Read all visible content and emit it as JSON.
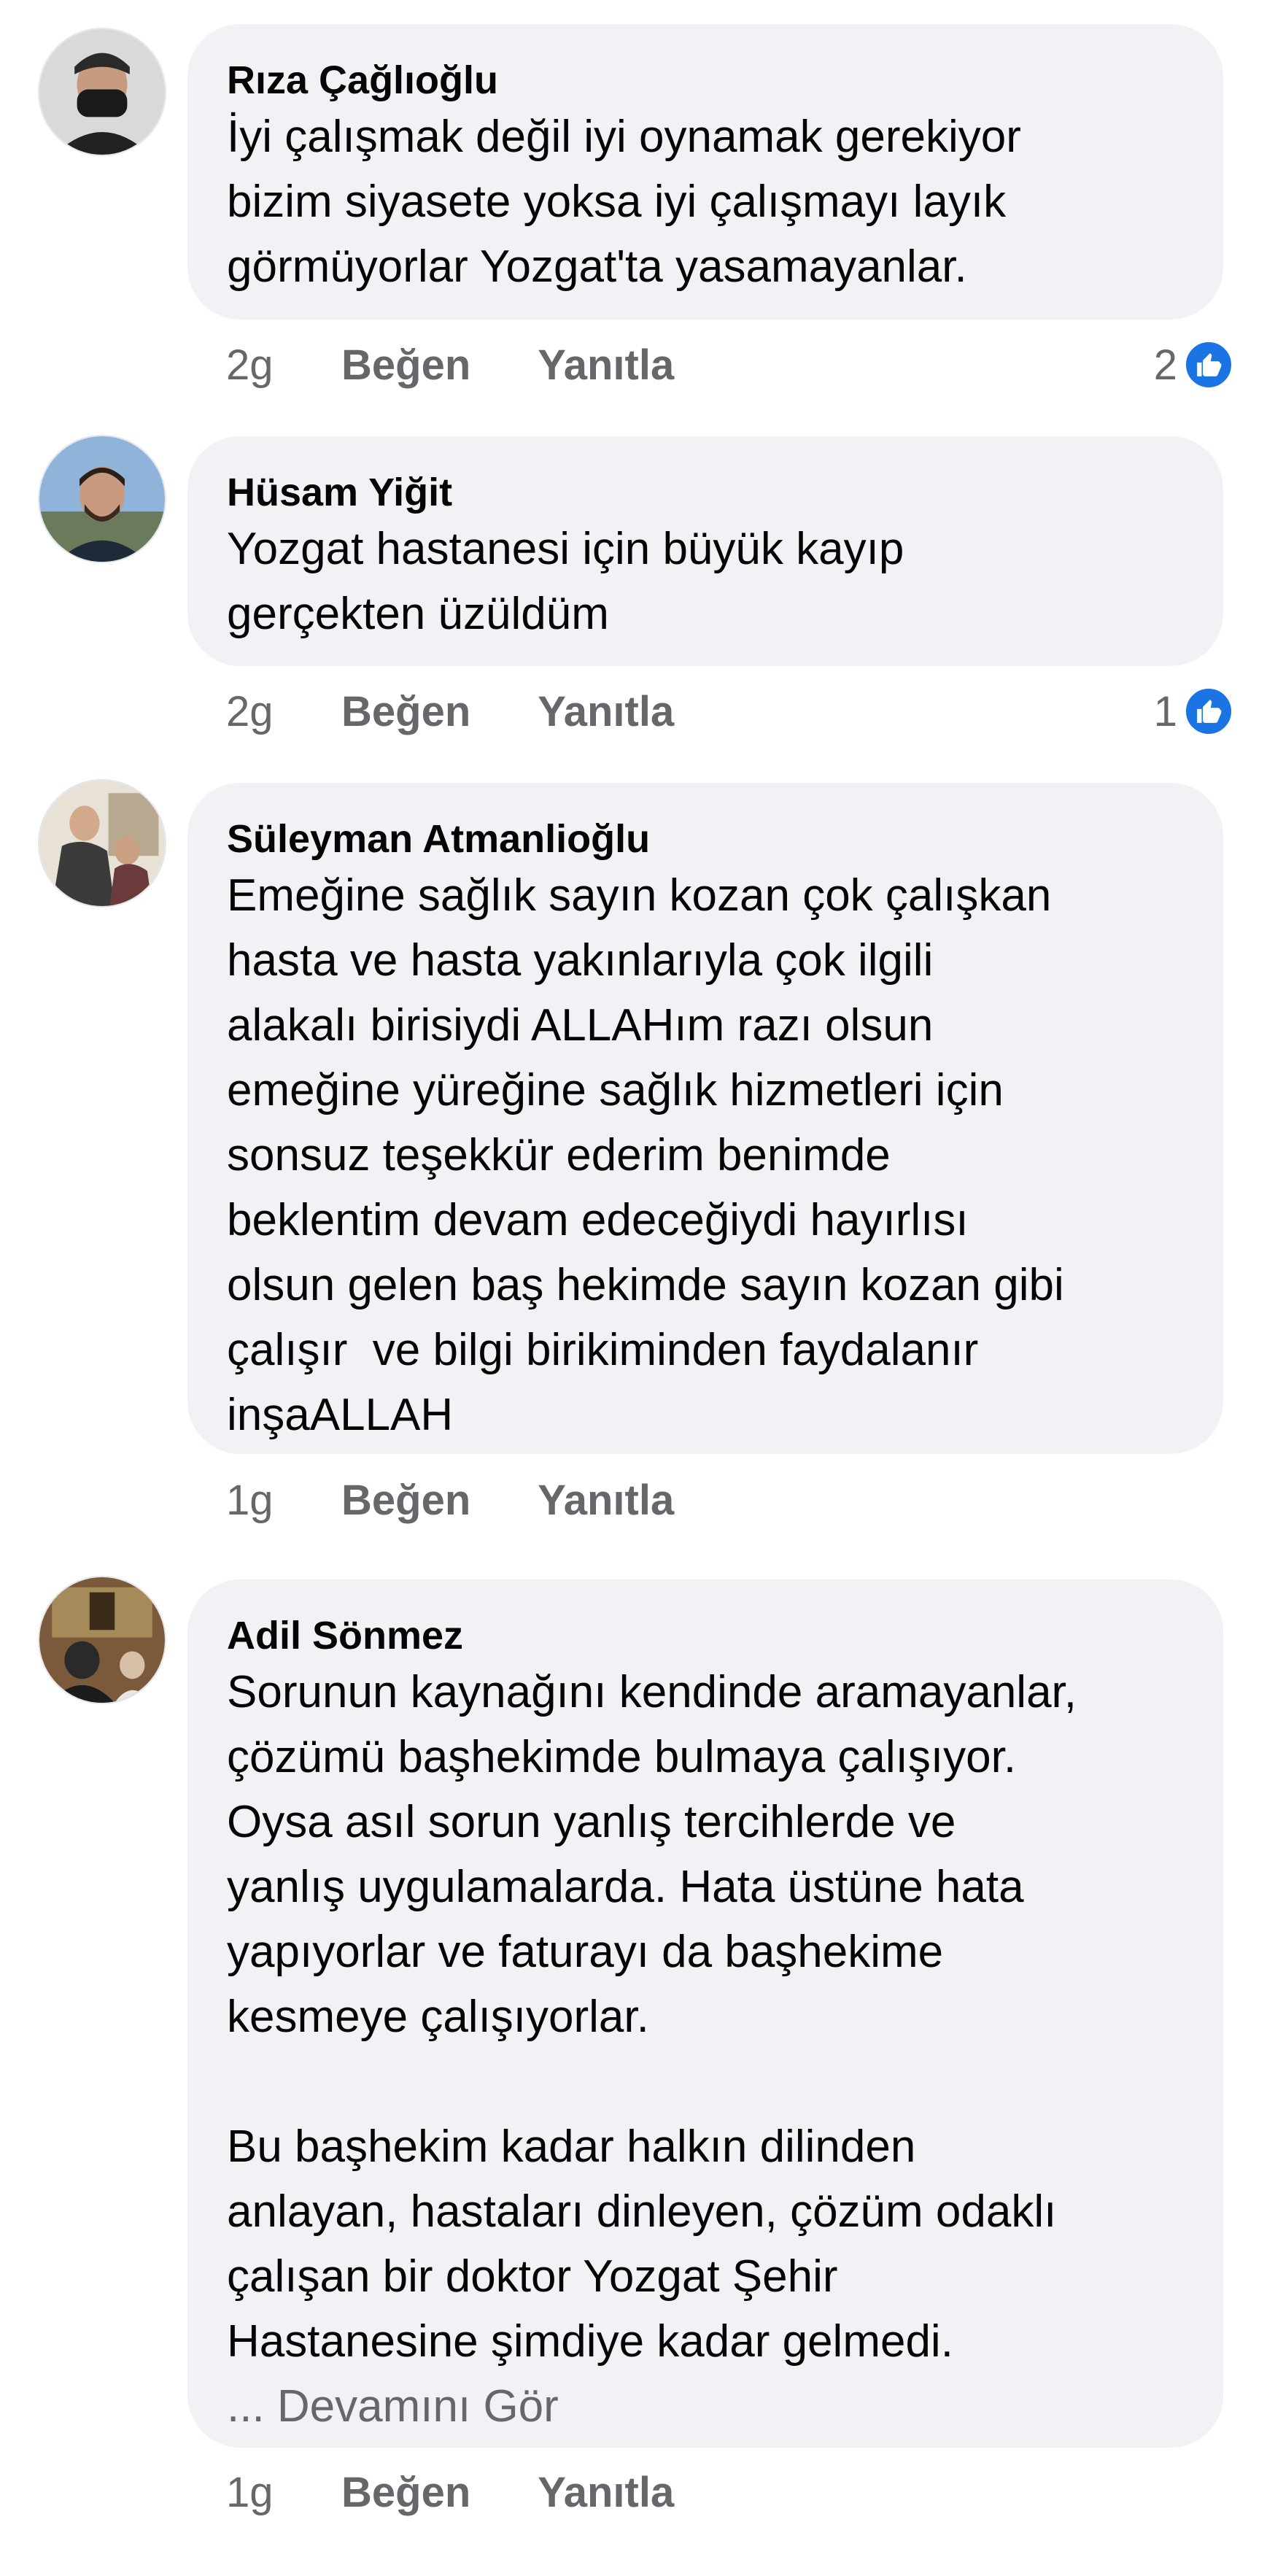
{
  "comments": [
    {
      "author": "Rıza Çağlıoğlu",
      "text": "İyi çalışmak değil iyi oynamak gerekiyor\nbizim siyasete yoksa iyi çalışmayı layık\ngörmüyorlar Yozgat'ta yasamayanlar.",
      "time": "2g",
      "like_label": "Beğen",
      "reply_label": "Yanıtla",
      "reaction_count": "2",
      "avatar_icon": "profile-photo"
    },
    {
      "author": "Hüsam Yiğit",
      "text": "Yozgat hastanesi için büyük kayıp\ngerçekten üzüldüm",
      "time": "2g",
      "like_label": "Beğen",
      "reply_label": "Yanıtla",
      "reaction_count": "1",
      "avatar_icon": "profile-photo"
    },
    {
      "author": "Süleyman Atmanlioğlu",
      "text": "Emeğine sağlık sayın kozan çok çalışkan\nhasta ve hasta yakınlarıyla çok ilgili\nalakalı birisiydi ALLAHım razı olsun\nemeğine yüreğine sağlık hizmetleri için\nsonsuz teşekkür ederim benimde\nbeklentim devam edeceğiydi hayırlısı\nolsun gelen baş hekimde sayın kozan gibi\nçalışır  ve bilgi birikiminden faydalanır\ninşaALLAH",
      "time": "1g",
      "like_label": "Beğen",
      "reply_label": "Yanıtla",
      "avatar_icon": "profile-photo"
    },
    {
      "author": "Adil Sönmez",
      "text": "Sorunun kaynağını kendinde aramayanlar,\nçözümü başhekimde bulmaya çalışıyor.\nOysa asıl sorun yanlış tercihlerde ve\nyanlış uygulamalarda. Hata üstüne hata\nyapıyorlar ve faturayı da başhekime\nkesmeye çalışıyorlar.\n\nBu başhekim kadar halkın dilinden\nanlayan, hastaları dinleyen, çözüm odaklı\nçalışan bir doktor Yozgat Şehir\nHastanesine şimdiye kadar gelmedi.",
      "see_more": "... Devamını Gör",
      "time": "1g",
      "like_label": "Beğen",
      "reply_label": "Yanıtla",
      "avatar_icon": "profile-photo"
    }
  ],
  "colors": {
    "bubble": "#f0f2f5",
    "meta_text": "#65676b",
    "like_blue": "#1b74e4"
  }
}
